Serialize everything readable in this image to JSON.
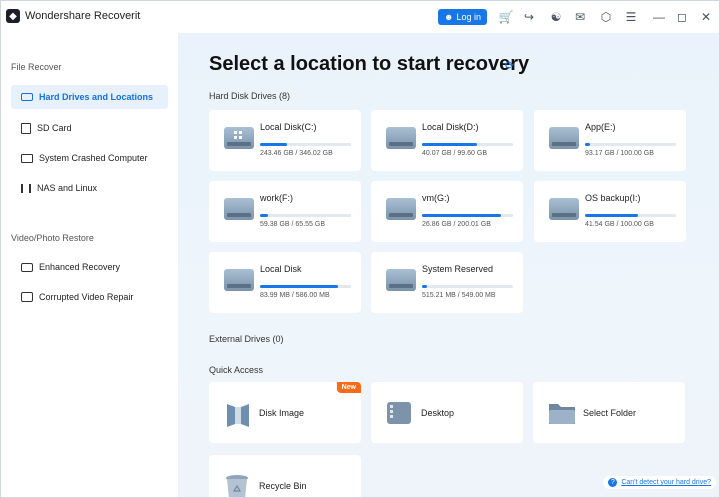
{
  "app": {
    "title": "Wondershare Recoverit",
    "login_label": "Log in"
  },
  "sidebar": {
    "section1": "File Recover",
    "items1": [
      {
        "label": "Hard Drives and Locations"
      },
      {
        "label": "SD Card"
      },
      {
        "label": "System Crashed Computer"
      },
      {
        "label": "NAS and Linux"
      }
    ],
    "section2": "Video/Photo Restore",
    "items2": [
      {
        "label": "Enhanced Recovery"
      },
      {
        "label": "Corrupted Video Repair"
      }
    ]
  },
  "main": {
    "title": "Select a location to start recovery",
    "hdd_label": "Hard Disk Drives (8)",
    "drives": [
      {
        "name": "Local Disk(C:)",
        "size": "243.46 GB / 346.02 GB",
        "used": 0.3
      },
      {
        "name": "Local Disk(D:)",
        "size": "40.07 GB / 99.60 GB",
        "used": 0.6
      },
      {
        "name": "App(E:)",
        "size": "93.17 GB / 100.00 GB",
        "used": 0.05
      },
      {
        "name": "work(F:)",
        "size": "59.38 GB / 65.55 GB",
        "used": 0.09
      },
      {
        "name": "vm(G:)",
        "size": "26.86 GB / 200.01 GB",
        "used": 0.87
      },
      {
        "name": "OS backup(I:)",
        "size": "41.54 GB / 100.00 GB",
        "used": 0.58
      },
      {
        "name": "Local Disk",
        "size": "83.99 MB / 586.00 MB",
        "used": 0.86
      },
      {
        "name": "System Reserved",
        "size": "515.21 MB / 549.00 MB",
        "used": 0.06
      }
    ],
    "external_label": "External Drives (0)",
    "quick_label": "Quick Access",
    "quick": [
      {
        "label": "Disk Image",
        "badge": "New"
      },
      {
        "label": "Desktop"
      },
      {
        "label": "Select Folder"
      },
      {
        "label": "Recycle Bin"
      }
    ],
    "help_text": "Can't detect your hard drive?"
  },
  "colors": {
    "accent": "#1877e8",
    "badge": "#ff6a1a"
  }
}
